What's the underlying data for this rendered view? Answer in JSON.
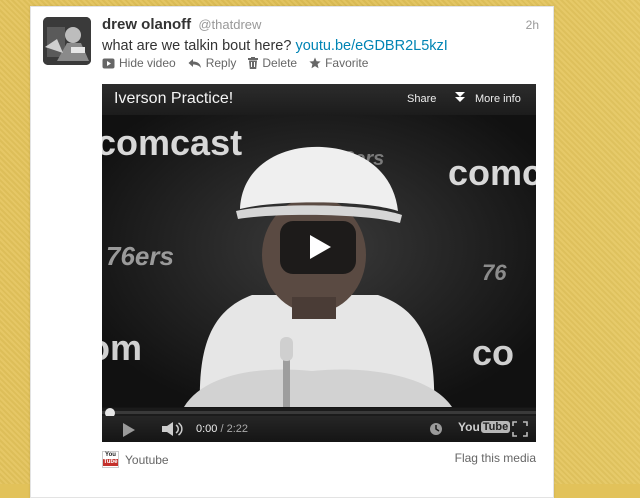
{
  "tweet": {
    "author_name": "drew olanoff",
    "author_handle": "@thatdrew",
    "timestamp": "2h",
    "text": "what are we talkin bout here?",
    "link": "youtu.be/eGDBR2L5kzI"
  },
  "actions": [
    {
      "label": "Hide video",
      "icon": "video-icon"
    },
    {
      "label": "Reply",
      "icon": "reply-icon"
    },
    {
      "label": "Delete",
      "icon": "trash-icon"
    },
    {
      "label": "Favorite",
      "icon": "star-icon"
    }
  ],
  "player": {
    "title": "Iverson Practice!",
    "share_label": "Share",
    "more_info_label": "More info",
    "current_time": "0:00",
    "duration": "/ 2:22",
    "progress": 0,
    "youtube_logo_left": "You",
    "youtube_logo_right": "Tube",
    "background_words": [
      "comcast",
      "76ers",
      "comcast"
    ]
  },
  "footer": {
    "source_label": "Youtube",
    "flag_label": "Flag this media"
  },
  "colors": {
    "link": "#0084b4",
    "page_background": "#e2c25a",
    "card": "#ffffff"
  }
}
